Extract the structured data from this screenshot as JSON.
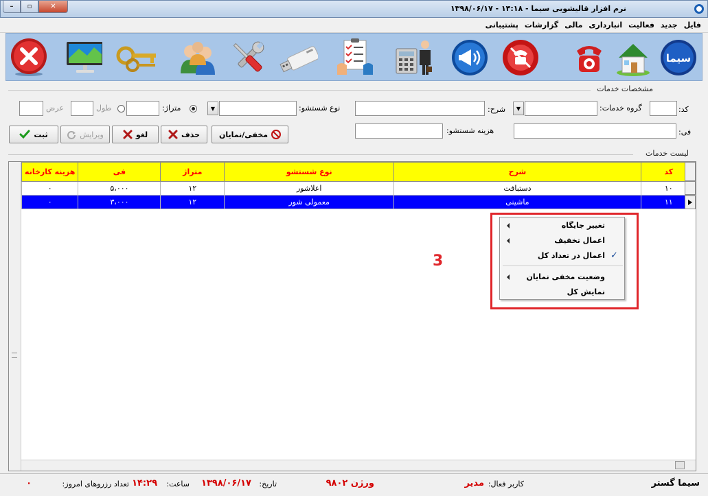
{
  "window": {
    "title": "نرم افزار قالیشویی سیما   -   ۱۴:۱۸   -   ۱۳۹۸/۰۶/۱۷",
    "min_label": "–",
    "max_label": "▫",
    "close_label": "✕"
  },
  "menu": [
    "فایل",
    "جدید",
    "فعالیت",
    "انبارداری",
    "مالی",
    "گزارشات",
    "پشتیبانی"
  ],
  "toolbar": {
    "icons": [
      "sima-logo-icon",
      "home-icon",
      "phone-icon",
      "phone-block-icon",
      "megaphone-icon",
      "accountant-icon",
      "checklist-icon",
      "usb-drive-icon",
      "tools-icon",
      "users-icon",
      "keys-icon",
      "monitor-icon",
      "exit-icon"
    ],
    "logo_text": "سیما"
  },
  "services_details": {
    "title": "مشخصات خدمات",
    "code_label": "کد:",
    "group_label": "گروه خدمات:",
    "desc_label": "شرح:",
    "wash_type_label": "نوع شستشو:",
    "area_label": "متراژ:",
    "length_label": "طول",
    "width_label": "عرض",
    "price_label": "فی:",
    "wash_cost_label": "هزینه شستشو:",
    "buttons": {
      "toggle": "مخفی/نمایان",
      "delete": "حذف",
      "cancel": "لغو",
      "edit": "ویرایش",
      "save": "ثبت"
    }
  },
  "services_list": {
    "title": "لیست خدمات",
    "columns": [
      "کد",
      "شرح",
      "نوع شستشو",
      "متراژ",
      "فی",
      "هزینه کارخانه"
    ],
    "rows": [
      [
        "۱۰",
        "دستبافت",
        "اعلاشور",
        "۱۲",
        "۵،۰۰۰",
        "۰"
      ],
      [
        "۱۱",
        "ماشینی",
        "معمولی شور",
        "۱۲",
        "۳،۰۰۰",
        "۰"
      ]
    ]
  },
  "context_menu": {
    "items": [
      "تغییر جایگاه",
      "اعمال تخفیف",
      "اعمال در تعداد کل",
      "وضعیت مخفی نمایان",
      "نمایش کل"
    ],
    "annotation": "3"
  },
  "status_bar": {
    "brand": "سیما گستر",
    "user_label": "کاربر فعال:",
    "user_value": "مدیر",
    "version": "ورژن ۹۸۰۲",
    "date_label": "تاریخ:",
    "date_value": "۱۳۹۸/۰۶/۱۷",
    "time_label": "ساعت:",
    "time_value": "۱۴:۲۹",
    "reservations_label": "تعداد رزروهای امروز:",
    "reservations_value": "۰"
  }
}
